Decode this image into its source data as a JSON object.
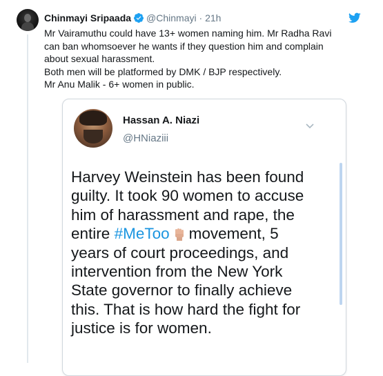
{
  "tweet": {
    "author_name": "Chinmayi Sripaada",
    "author_handle": "@Chinmayi",
    "separator": "·",
    "time": "21h",
    "text_lines": [
      "Mr Vairamuthu could have 13+ women naming him. Mr Radha Ravi",
      "can ban whomsoever he wants if they question him and complain",
      "about sexual harassment.",
      "Both men will be platformed by DMK / BJP respectively.",
      "Mr Anu Malik - 6+ women in public."
    ],
    "icons": {
      "verified": "verified-badge-icon",
      "brand": "twitter-bird-icon"
    },
    "colors": {
      "brand": "#1da1f2",
      "secondary_text": "#657786"
    }
  },
  "embed": {
    "author_name": "Hassan A. Niazi",
    "author_handle": "@HNiaziii",
    "lines": [
      "Harvey Weinstein has been found",
      "guilty. It took 90 women to accuse",
      "him of harassment and rape, the"
    ],
    "line4_before": "entire",
    "hashtag": "#MeToo",
    "line4_after": "movement, 5",
    "lines_rest": [
      "years of court proceedings, and",
      "intervention from the New York",
      "State governor to finally achieve",
      "this. That is how hard the fight for",
      "justice is for women."
    ],
    "icons": {
      "menu": "chevron-down-icon",
      "emoji": "raised-fist-icon"
    },
    "colors": {
      "hashtag": "#1b95e0"
    }
  }
}
